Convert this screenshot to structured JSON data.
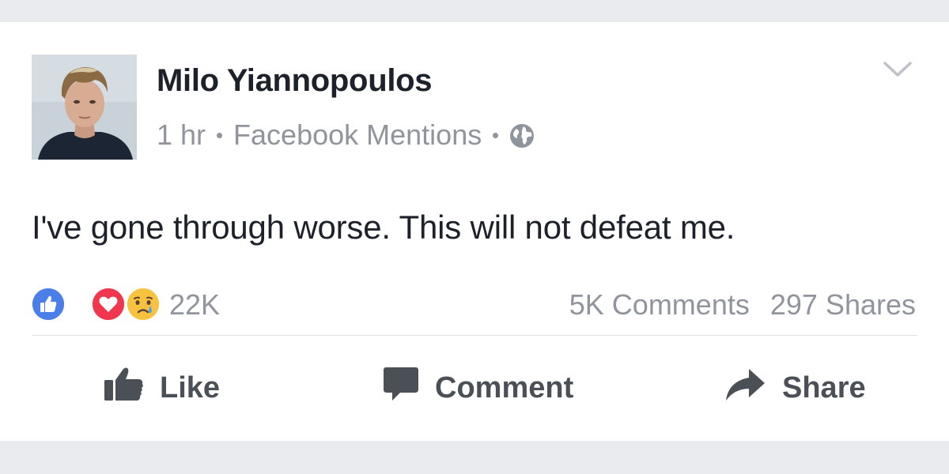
{
  "post": {
    "author": "Milo Yiannopoulos",
    "time": "1 hr",
    "source": "Facebook Mentions",
    "privacy_icon": "globe-icon",
    "text": "I've gone through worse. This will not defeat me."
  },
  "reactions": {
    "types": [
      "like-icon",
      "love-icon",
      "sad-icon"
    ],
    "count": "22K"
  },
  "engagement": {
    "comments": "5K Comments",
    "shares": "297 Shares"
  },
  "actions": {
    "like_label": "Like",
    "comment_label": "Comment",
    "share_label": "Share"
  },
  "colors": {
    "like_blue": "#4a7ee8",
    "love_red": "#f0374d",
    "sad_yellow": "#f7c240",
    "text_primary": "#1d2129",
    "text_secondary": "#90949c",
    "action_gray": "#4b4f56",
    "feed_background": "#e9ebee"
  }
}
